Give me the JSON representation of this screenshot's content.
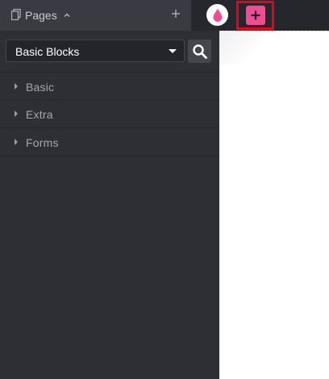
{
  "header": {
    "pages_label": "Pages",
    "icons": {
      "pages": "pages-icon",
      "collapse": "chevron-up-icon",
      "add_page": "plus-icon",
      "drop": "drop-icon",
      "add_block": "plus-square-icon"
    }
  },
  "sidebar": {
    "category_select": {
      "value": "Basic Blocks"
    },
    "search_icon": "search-icon",
    "categories": [
      {
        "label": "Basic"
      },
      {
        "label": "Extra"
      },
      {
        "label": "Forms"
      }
    ]
  },
  "colors": {
    "accent_pink": "#ee4c93",
    "highlight_red": "#e8001e",
    "sidebar_bg": "#2e2f35",
    "topbar_bg": "#26272c"
  }
}
